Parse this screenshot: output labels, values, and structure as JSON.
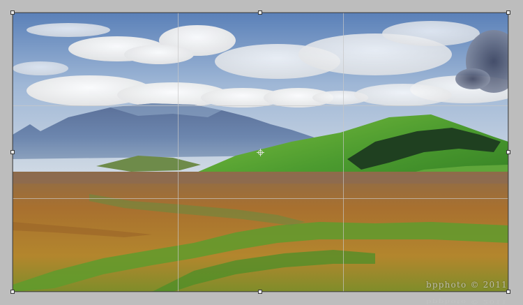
{
  "watermark": {
    "text": "bpphoto © 2011"
  },
  "overlay": {
    "grid": "rule-of-thirds"
  },
  "colors": {
    "sky_top": "#6f93c6",
    "sky_mid": "#b9cbe0",
    "mountain": "#4f6e98",
    "hill_green": "#4d9a32",
    "forest": "#1f4020",
    "plain_ochre": "#a9742c",
    "plain_green": "#5e9a2a"
  },
  "icons": {
    "handle": "crop-handle-icon",
    "pivot": "crosshair-icon"
  }
}
